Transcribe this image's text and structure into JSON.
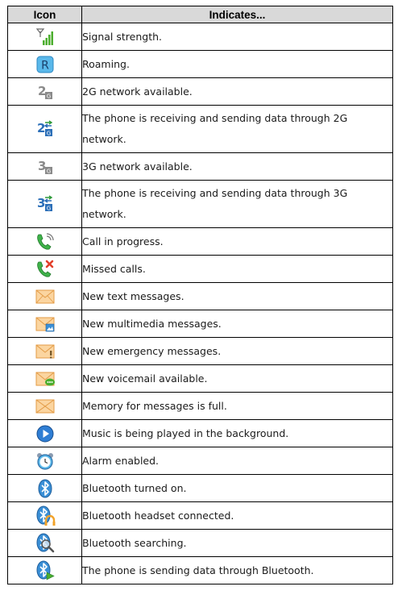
{
  "header": {
    "icon_label": "Icon",
    "indicates_label": "Indicates..."
  },
  "rows": [
    {
      "icon": "signal-strength-icon",
      "text": "Signal strength."
    },
    {
      "icon": "roaming-icon",
      "text": "Roaming."
    },
    {
      "icon": "2g-network-icon",
      "text": "2G network available."
    },
    {
      "icon": "2g-data-transfer-icon",
      "text": "The phone is receiving and sending data through 2G network."
    },
    {
      "icon": "3g-network-icon",
      "text": "3G network available."
    },
    {
      "icon": "3g-data-transfer-icon",
      "text": "The phone is receiving and sending data through 3G network."
    },
    {
      "icon": "call-in-progress-icon",
      "text": "Call in progress."
    },
    {
      "icon": "missed-call-icon",
      "text": "Missed calls."
    },
    {
      "icon": "text-message-icon",
      "text": "New text messages."
    },
    {
      "icon": "multimedia-message-icon",
      "text": "New multimedia messages."
    },
    {
      "icon": "emergency-message-icon",
      "text": "New emergency messages."
    },
    {
      "icon": "voicemail-icon",
      "text": "New voicemail available."
    },
    {
      "icon": "memory-full-icon",
      "text": "Memory for messages is full."
    },
    {
      "icon": "music-playing-icon",
      "text": "Music is being played in the background."
    },
    {
      "icon": "alarm-icon",
      "text": "Alarm enabled."
    },
    {
      "icon": "bluetooth-on-icon",
      "text": "Bluetooth turned on."
    },
    {
      "icon": "bluetooth-headset-icon",
      "text": "Bluetooth headset connected."
    },
    {
      "icon": "bluetooth-searching-icon",
      "text": "Bluetooth searching."
    },
    {
      "icon": "bluetooth-sending-icon",
      "text": "The phone is sending data through Bluetooth."
    }
  ],
  "colors": {
    "header_bg": "#d9d9d9",
    "signal_green": "#4cae2e",
    "roaming_blue": "#5ab8ea",
    "envelope_orange": "#f2b46a",
    "bluetooth_blue": "#3a8fd6",
    "missed_red": "#e2402a"
  }
}
